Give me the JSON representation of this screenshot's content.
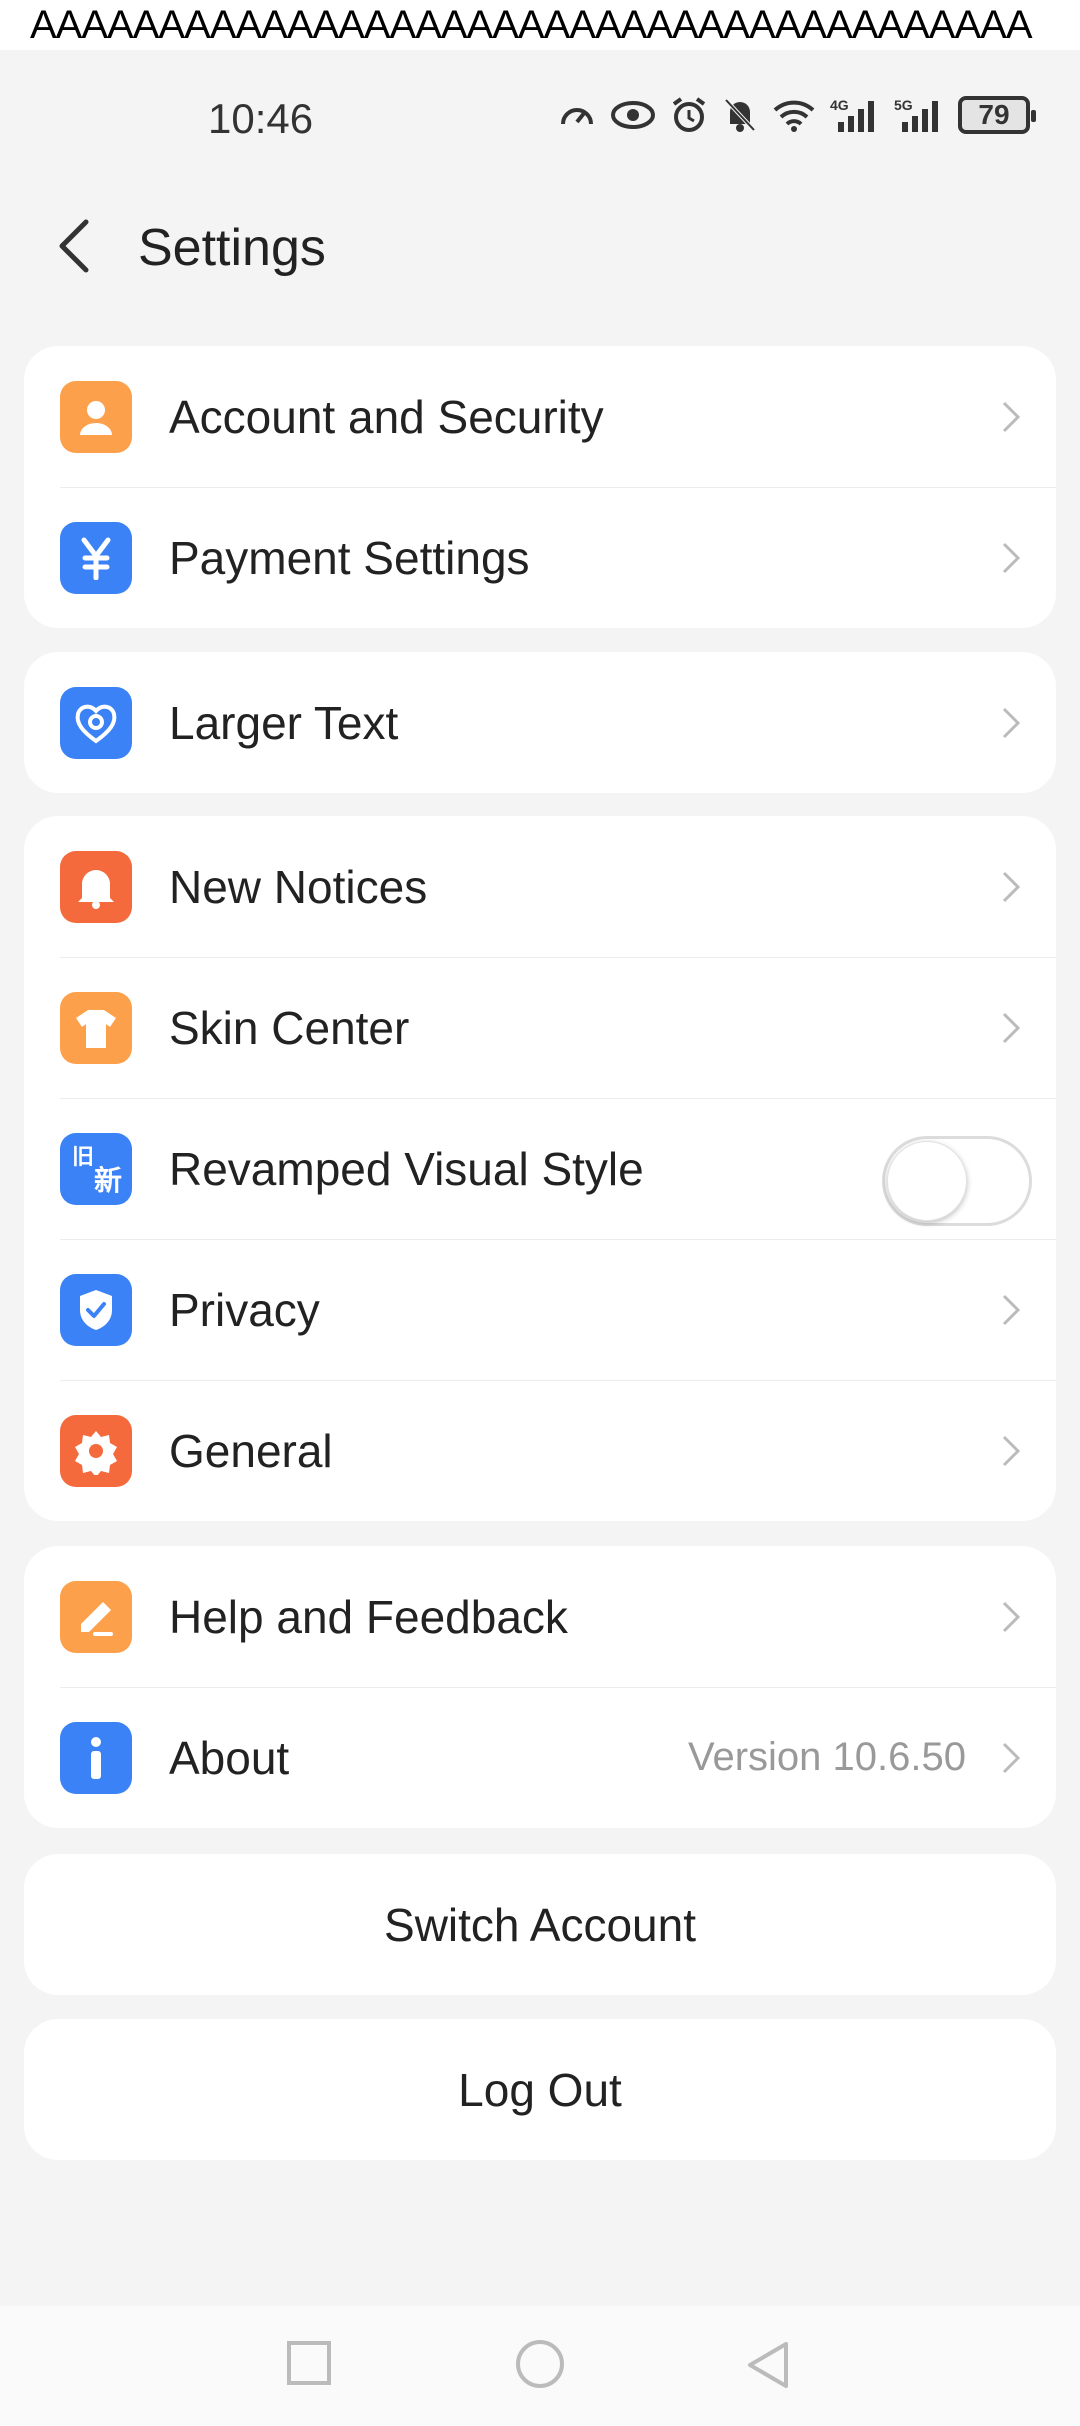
{
  "banner": {
    "text": "AAAAAAAAAAAAAAAAAAAAAAAAAAAAAAAAAAAAAAA"
  },
  "status": {
    "time": "10:46",
    "battery": "79",
    "net1": "4G",
    "net2": "5G"
  },
  "header": {
    "title": "Settings"
  },
  "groups": {
    "g1": {
      "account": {
        "label": "Account and Security",
        "icon": "person-icon",
        "color": "#fda04b"
      },
      "payment": {
        "label": "Payment Settings",
        "icon": "yen-icon",
        "color": "#3b82f6"
      }
    },
    "g2": {
      "larger_text": {
        "label": "Larger Text",
        "icon": "heart-shield-icon",
        "color": "#3b82f6"
      }
    },
    "g3": {
      "notices": {
        "label": "New Notices",
        "icon": "bell-icon",
        "color": "#f56a3d"
      },
      "skin": {
        "label": "Skin Center",
        "icon": "shirt-icon",
        "color": "#fda04b"
      },
      "revamped": {
        "label": "Revamped Visual Style",
        "icon": "old-new-icon",
        "icon_text_top": "旧",
        "icon_text_bottom": "新",
        "color": "#3b82f6",
        "toggle_on": false
      },
      "privacy": {
        "label": "Privacy",
        "icon": "shield-check-icon",
        "color": "#3b82f6"
      },
      "general": {
        "label": "General",
        "icon": "gear-icon",
        "color": "#f56a3d"
      }
    },
    "g4": {
      "help": {
        "label": "Help and Feedback",
        "icon": "edit-icon",
        "color": "#fda04b"
      },
      "about": {
        "label": "About",
        "value": "Version 10.6.50",
        "icon": "info-icon",
        "color": "#3b82f6"
      }
    }
  },
  "buttons": {
    "switch_account": "Switch Account",
    "log_out": "Log Out"
  }
}
